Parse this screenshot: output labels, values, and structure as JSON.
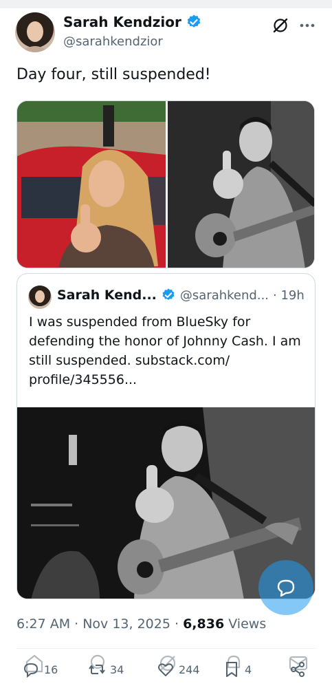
{
  "author": {
    "name": "Sarah Kendzior",
    "handle": "@sarahkendzior"
  },
  "tweet": {
    "text": "Day four, still suspended!"
  },
  "quoted": {
    "name": "Sarah Kend...",
    "handle": "@sarahkend...",
    "time": "· 19h",
    "text": "I was suspended from BlueSky for defending the honor of Johnny Cash. I am still suspended. substack.com/ profile/345556..."
  },
  "meta": {
    "time": "6:27 AM · Nov 13, 2025 · ",
    "views_count": "6,836",
    "views_label": " Views"
  },
  "actions": {
    "replies": "16",
    "reposts": "34",
    "likes": "244",
    "bookmarks": "4"
  },
  "icons": {
    "verified": "verified-badge-icon",
    "grok": "grok-icon",
    "more": "more-icon",
    "reply": "reply-icon",
    "repost": "repost-icon",
    "like": "like-icon",
    "bookmark": "bookmark-icon",
    "share": "share-icon",
    "compose": "compose-icon"
  },
  "colors": {
    "accent": "#1d9bf0",
    "text": "#0f1419",
    "secondary": "#536471",
    "border": "#cfd9de"
  }
}
